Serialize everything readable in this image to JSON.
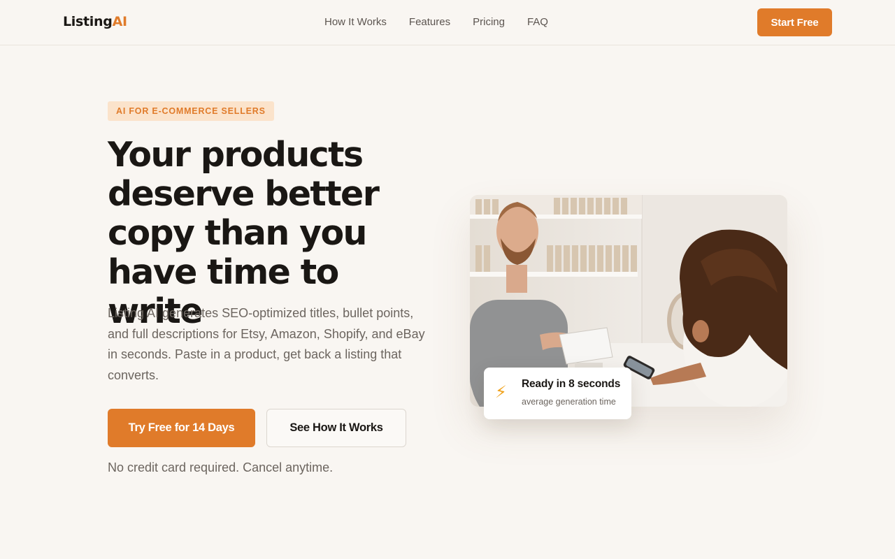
{
  "header": {
    "logo_main": "Listing",
    "logo_accent": "AI",
    "nav": [
      "How It Works",
      "Features",
      "Pricing",
      "FAQ"
    ],
    "cta": "Start Free"
  },
  "hero": {
    "badge": "AI FOR E-COMMERCE SELLERS",
    "headline": "Your products deserve better copy than you have time to write",
    "subtext": "Listing AI generates SEO-optimized titles, bullet points, and full descriptions for Etsy, Amazon, Shopify, and eBay in seconds. Paste in a product, get back a listing that converts.",
    "primary_button": "Try Free for 14 Days",
    "secondary_button": "See How It Works",
    "fine_print": "No credit card required. Cancel anytime."
  },
  "stat_card": {
    "icon": "lightning-icon",
    "title": "Ready in 8 seconds",
    "subtitle": "average generation time"
  },
  "colors": {
    "accent": "#e07b2a",
    "background": "#f9f6f2",
    "badge_bg": "#fbe3cb",
    "text": "#1a1714",
    "muted": "#6c655f"
  }
}
